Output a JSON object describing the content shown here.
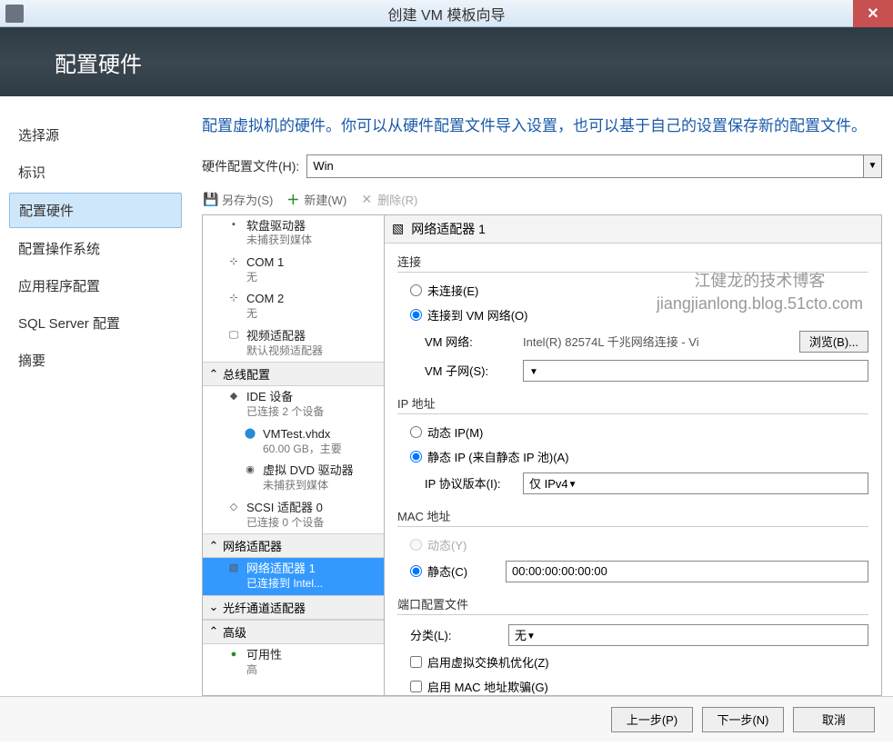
{
  "window": {
    "title": "创建 VM 模板向导",
    "close": "✕"
  },
  "header": {
    "title": "配置硬件"
  },
  "sidebar": {
    "items": [
      {
        "label": "选择源"
      },
      {
        "label": "标识"
      },
      {
        "label": "配置硬件"
      },
      {
        "label": "配置操作系统"
      },
      {
        "label": "应用程序配置"
      },
      {
        "label": "SQL Server 配置"
      },
      {
        "label": "摘要"
      }
    ]
  },
  "content": {
    "instruction": "配置虚拟机的硬件。你可以从硬件配置文件导入设置，也可以基于自己的设置保存新的配置文件。",
    "profile_label": "硬件配置文件(H):",
    "profile_value": "Win",
    "toolbar": {
      "save_as": "另存为(S)",
      "new": "新建(W)",
      "delete": "删除(R)"
    }
  },
  "tree": {
    "floppy": {
      "name": "软盘驱动器",
      "sub": "未捕获到媒体"
    },
    "com1": {
      "name": "COM 1",
      "sub": "无"
    },
    "com2": {
      "name": "COM 2",
      "sub": "无"
    },
    "video": {
      "name": "视频适配器",
      "sub": "默认视频适配器"
    },
    "cat_bus": "总线配置",
    "ide": {
      "name": "IDE 设备",
      "sub": "已连接 2 个设备"
    },
    "vhd": {
      "name": "VMTest.vhdx",
      "sub": "60.00 GB，主要"
    },
    "dvd": {
      "name": "虚拟 DVD 驱动器",
      "sub": "未捕获到媒体"
    },
    "scsi": {
      "name": "SCSI 适配器 0",
      "sub": "已连接 0 个设备"
    },
    "cat_net": "网络适配器",
    "nic": {
      "name": "网络适配器 1",
      "sub": "已连接到 Intel..."
    },
    "cat_fc": "光纤通道适配器",
    "cat_adv": "高级",
    "avail": {
      "name": "可用性",
      "sub": "高"
    }
  },
  "detail": {
    "header": "网络适配器 1",
    "conn": {
      "legend": "连接",
      "not_connected": "未连接(E)",
      "connected": "连接到 VM 网络(O)",
      "vm_net_label": "VM 网络:",
      "vm_net_value": "Intel(R) 82574L 千兆网络连接 - Vi",
      "browse": "浏览(B)...",
      "vm_subnet_label": "VM 子网(S):"
    },
    "ip": {
      "legend": "IP 地址",
      "dynamic": "动态 IP(M)",
      "static": "静态 IP (来自静态 IP 池)(A)",
      "proto_label": "IP 协议版本(I):",
      "proto_value": "仅 IPv4"
    },
    "mac": {
      "legend": "MAC 地址",
      "dynamic": "动态(Y)",
      "static": "静态(C)",
      "value": "00:00:00:00:00:00"
    },
    "port": {
      "legend": "端口配置文件",
      "class_label": "分类(L):",
      "class_value": "无",
      "opt1": "启用虚拟交换机优化(Z)",
      "opt2": "启用 MAC 地址欺骗(G)"
    },
    "watermark": {
      "line1": "江健龙的技术博客",
      "line2": "jiangjianlong.blog.51cto.com"
    }
  },
  "footer": {
    "prev": "上一步(P)",
    "next": "下一步(N)",
    "cancel": "取消"
  }
}
